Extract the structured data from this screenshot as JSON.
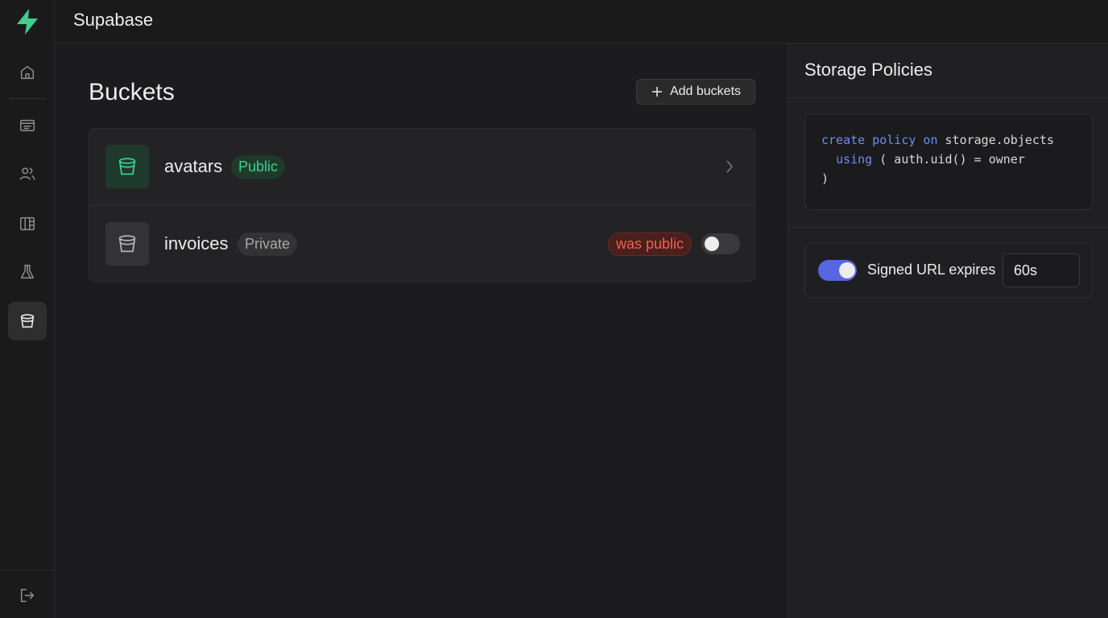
{
  "app": {
    "title": "Supabase",
    "brand_color": "#3ecf8e"
  },
  "sidebar": {
    "items": [
      {
        "name": "home",
        "icon": "home-icon",
        "active": false
      },
      {
        "name": "table-editor",
        "icon": "table-icon",
        "active": false
      },
      {
        "name": "authentication",
        "icon": "users-icon",
        "active": false
      },
      {
        "name": "database",
        "icon": "database-icon",
        "active": false
      },
      {
        "name": "sql-editor",
        "icon": "flask-icon",
        "active": false
      },
      {
        "name": "storage",
        "icon": "bucket-icon",
        "active": true
      }
    ],
    "bottom": {
      "name": "logout",
      "icon": "logout-icon"
    }
  },
  "main": {
    "title": "Buckets",
    "add_button_label": "Add buckets",
    "buckets": [
      {
        "name": "avatars",
        "visibility": "Public",
        "status": "",
        "toggle": null
      },
      {
        "name": "invoices",
        "visibility": "Private",
        "status": "was public",
        "toggle": "off"
      }
    ]
  },
  "panel": {
    "title": "Storage Policies",
    "code": {
      "line1_kw1": "create policy on",
      "line1_rest": " storage.objects",
      "line2_kw": "using",
      "line2_rest": " ( auth.uid() = owner",
      "line3": ")"
    },
    "setting": {
      "label": "Signed URL expires",
      "value": "60s",
      "toggle": "on"
    }
  },
  "colors": {
    "accent": "#5566e0",
    "public_green": "#3ecf8e",
    "warning_red": "#f0614f"
  }
}
